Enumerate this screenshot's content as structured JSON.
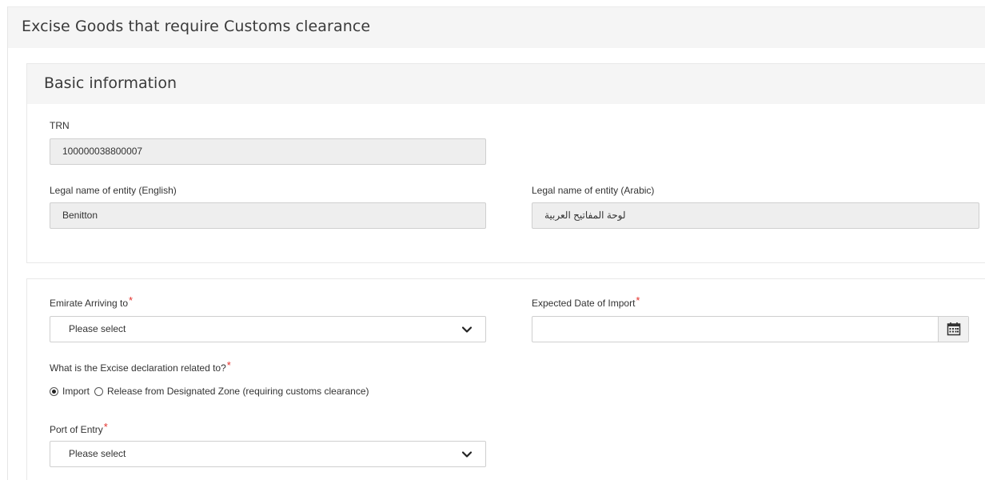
{
  "page": {
    "title": "Excise Goods that require Customs clearance"
  },
  "basic_info": {
    "title": "Basic information",
    "trn": {
      "label": "TRN",
      "value": "100000038800007"
    },
    "legal_name_en": {
      "label": "Legal name of entity (English)",
      "value": "Benitton"
    },
    "legal_name_ar": {
      "label": "Legal name of entity (Arabic)",
      "value": "لوحة المفاتيح العربية"
    }
  },
  "details": {
    "emirate": {
      "label": "Emirate Arriving to",
      "value": "Please select",
      "required": "*"
    },
    "expected_date": {
      "label": "Expected Date of Import",
      "value": "",
      "required": "*"
    },
    "declaration": {
      "label": "What is the Excise declaration related to?",
      "required": "*",
      "options": [
        {
          "label": "Import",
          "checked": true
        },
        {
          "label": "Release from Designated Zone (requiring customs clearance)",
          "checked": false
        }
      ]
    },
    "port": {
      "label": "Port of Entry",
      "value": "Please select",
      "required": "*"
    }
  },
  "icons": {
    "select_arrow": "chevron-down-icon",
    "date_picker": "calendar-icon"
  },
  "colors": {
    "required": "#e4302b",
    "header_bg": "#f5f5f5",
    "readonly_bg": "#eeeeee"
  }
}
